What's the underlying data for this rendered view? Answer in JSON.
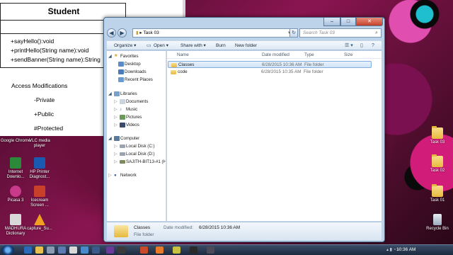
{
  "document": {
    "uml_title": "Student",
    "methods": [
      "+sayHello():void",
      "+printHello(String name):void",
      "+sendBanner(String name):String"
    ],
    "heading": "Access Modifications",
    "modifiers": [
      "-Private",
      "+Public",
      "#Protected"
    ]
  },
  "desktop_left": [
    {
      "label": "Google Chrome",
      "color": "#e8e8e8"
    },
    {
      "label": "VLC media player",
      "color": "#f08a1c"
    },
    {
      "label": "Internet Downlo...",
      "color": "#2a8a3a"
    },
    {
      "label": "HP Printer Diagnost...",
      "color": "#1a5ab0"
    },
    {
      "label": "Picasa 3",
      "color": "#c83a8a"
    },
    {
      "label": "Icecream Screen ...",
      "color": "#c8402a"
    },
    {
      "label": "MADHURA Dictionary",
      "color": "#d8d8d8"
    },
    {
      "label": "capture_Su...",
      "color": "#f0a020"
    }
  ],
  "desktop_right": [
    {
      "label": "Task 03"
    },
    {
      "label": "Task 02"
    },
    {
      "label": "Task 01"
    },
    {
      "label": "Recycle Bin"
    }
  ],
  "explorer": {
    "address": "Task 03",
    "search_placeholder": "Search Task 03",
    "toolbar": {
      "organize": "Organize",
      "open": "Open",
      "share_with": "Share with",
      "burn": "Burn",
      "new_folder": "New folder"
    },
    "nav": {
      "favorites": "Favorites",
      "favorites_items": [
        "Desktop",
        "Downloads",
        "Recent Places"
      ],
      "libraries": "Libraries",
      "libraries_items": [
        "Documents",
        "Music",
        "Pictures",
        "Videos"
      ],
      "computer": "Computer",
      "computer_items": [
        "Local Disk (C:)",
        "Local Disk (D:)",
        "SAJITH-BIT13-#1 (H"
      ],
      "network": "Network"
    },
    "columns": {
      "name": "Name",
      "date_modified": "Date modified",
      "type": "Type",
      "size": "Size"
    },
    "files": [
      {
        "name": "Classes",
        "date": "6/28/2015 10:36 AM",
        "type": "File folder",
        "selected": true
      },
      {
        "name": "code",
        "date": "6/28/2015 10:35 AM",
        "type": "File folder",
        "selected": false
      }
    ],
    "details": {
      "name": "Classes",
      "modified_label": "Date modified:",
      "modified_value": "6/28/2015 10:36 AM",
      "type": "File folder"
    }
  },
  "taskbar": {
    "clock": "10:36 AM"
  }
}
